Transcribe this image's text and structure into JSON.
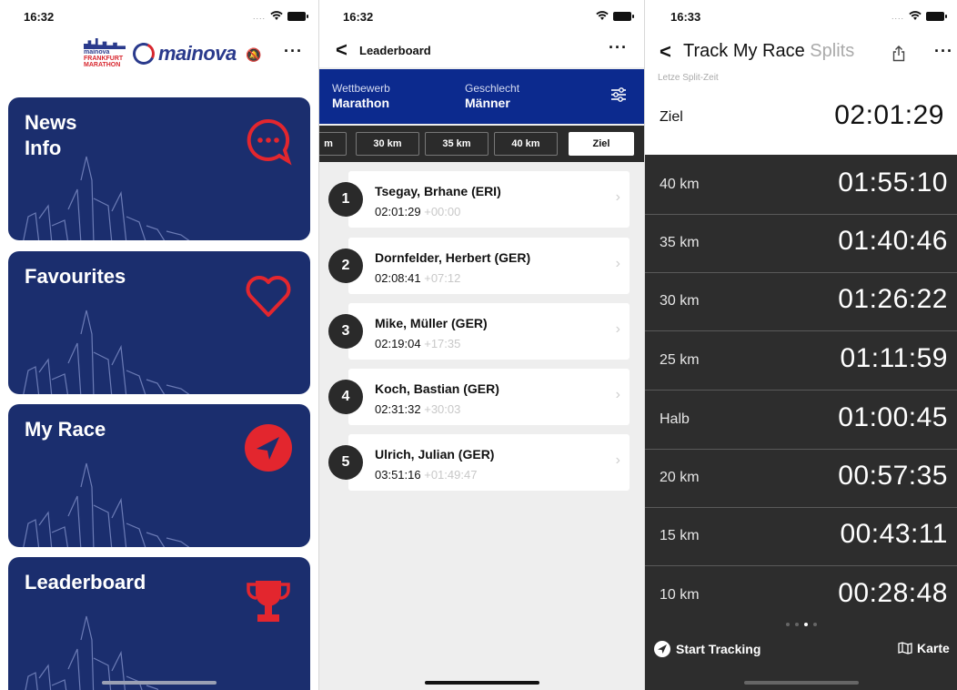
{
  "screen_home": {
    "status_time": "16:32",
    "brand_logo_text": [
      "mainova",
      "FRANKFURT",
      "MARATHON"
    ],
    "brand_name": "mainova",
    "more_label": "···",
    "cards": [
      {
        "title_line1": "News",
        "title_line2": "Info",
        "icon": "chat-bubble-icon"
      },
      {
        "title_line1": "Favourites",
        "title_line2": "",
        "icon": "heart-icon"
      },
      {
        "title_line1": "My Race",
        "title_line2": "",
        "icon": "navigation-arrow-icon"
      },
      {
        "title_line1": "Leaderboard",
        "title_line2": "",
        "icon": "trophy-icon"
      }
    ]
  },
  "screen_leaderboard": {
    "status_time": "16:32",
    "back_label": "<",
    "title": "Leaderboard",
    "more_label": "···",
    "filters": {
      "competition_label": "Wettbewerb",
      "competition_value": "Marathon",
      "gender_label": "Geschlecht",
      "gender_value": "Männer"
    },
    "tabs": [
      "m",
      "30 km",
      "35 km",
      "40 km",
      "Ziel"
    ],
    "active_tab": "Ziel",
    "rows": [
      {
        "rank": "1",
        "name": "Tsegay, Brhane (ERI)",
        "time": "02:01:29",
        "gap": "+00:00"
      },
      {
        "rank": "2",
        "name": "Dornfelder, Herbert (GER)",
        "time": "02:08:41",
        "gap": "+07:12"
      },
      {
        "rank": "3",
        "name": "Mike, Müller (GER)",
        "time": "02:19:04",
        "gap": "+17:35"
      },
      {
        "rank": "4",
        "name": "Koch, Bastian (GER)",
        "time": "02:31:32",
        "gap": "+30:03"
      },
      {
        "rank": "5",
        "name": "Ulrich, Julian (GER)",
        "time": "03:51:16",
        "gap": "+01:49:47"
      }
    ]
  },
  "screen_splits": {
    "status_time": "16:33",
    "back_label": "<",
    "title": "Track My Race",
    "subtitle": "Splits",
    "more_label": "···",
    "last_split_label": "Letze Split-Zeit",
    "finish": {
      "label": "Ziel",
      "time": "02:01:29"
    },
    "splits": [
      {
        "label": "40 km",
        "time": "01:55:10"
      },
      {
        "label": "35 km",
        "time": "01:40:46"
      },
      {
        "label": "30 km",
        "time": "01:26:22"
      },
      {
        "label": "25 km",
        "time": "01:11:59"
      },
      {
        "label": "Halb",
        "time": "01:00:45"
      },
      {
        "label": "20 km",
        "time": "00:57:35"
      },
      {
        "label": "15 km",
        "time": "00:43:11"
      },
      {
        "label": "10 km",
        "time": "00:28:48"
      }
    ],
    "start_tracking_label": "Start Tracking",
    "map_label": "Karte"
  },
  "colors": {
    "card_blue": "#1b2e6e",
    "accent_red": "#e3262e",
    "filter_blue": "#0c2a8e",
    "dark_panel": "#2d2d2d"
  }
}
